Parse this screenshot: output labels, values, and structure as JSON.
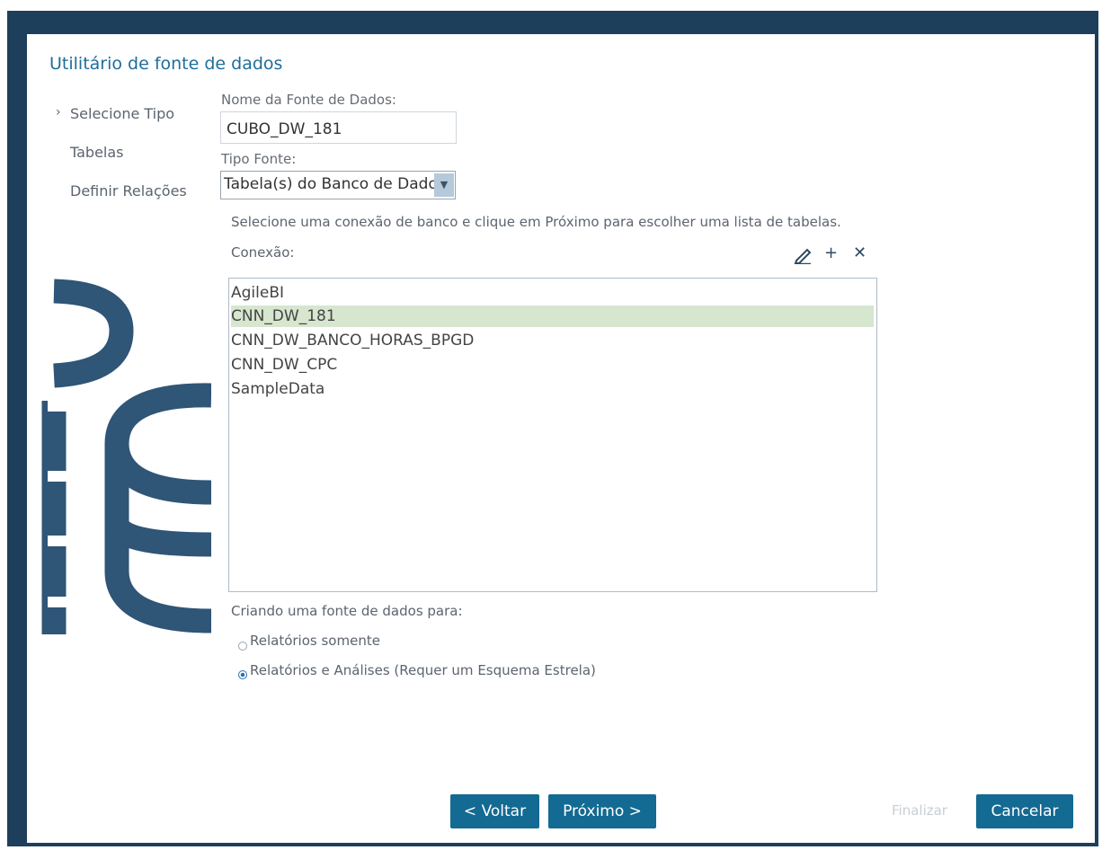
{
  "dialog": {
    "title": "Utilitário de fonte de dados",
    "steps": [
      {
        "label": "Selecione Tipo",
        "current": true
      },
      {
        "label": "Tabelas",
        "current": false
      },
      {
        "label": "Definir Relações",
        "current": false
      }
    ],
    "step_chevron": "›"
  },
  "form": {
    "name_label": "Nome da Fonte de Dados:",
    "name_value": "CUBO_DW_181",
    "type_label": "Tipo Fonte:",
    "type_value": "Tabela(s) do Banco de Dados",
    "hint": "Selecione uma conexão de banco e clique em Próximo para escolher uma lista de tabelas.",
    "connection_label": "Conexão:",
    "connection_tools": [
      "edit-icon",
      "add-icon",
      "remove-icon"
    ],
    "connections": [
      "AgileBI",
      "CNN_DW_181",
      "CNN_DW_BANCO_HORAS_BPGD",
      "CNN_DW_CPC",
      "SampleData"
    ],
    "selected_connection": "CNN_DW_181",
    "create_label": "Criando uma fonte de dados para:",
    "options": [
      {
        "label": "Relatórios somente",
        "checked": false
      },
      {
        "label": "Relatórios e Análises (Requer um Esquema Estrela)",
        "checked": true
      }
    ]
  },
  "buttons": {
    "back": "< Voltar",
    "next": "Próximo >",
    "finish": "Finalizar",
    "cancel": "Cancelar"
  },
  "colors": {
    "frame": "#1d3f5b",
    "title": "#1f6d9c",
    "button": "#136a92",
    "selected_row": "#d6e6cf",
    "decoration": "#2f5577"
  }
}
